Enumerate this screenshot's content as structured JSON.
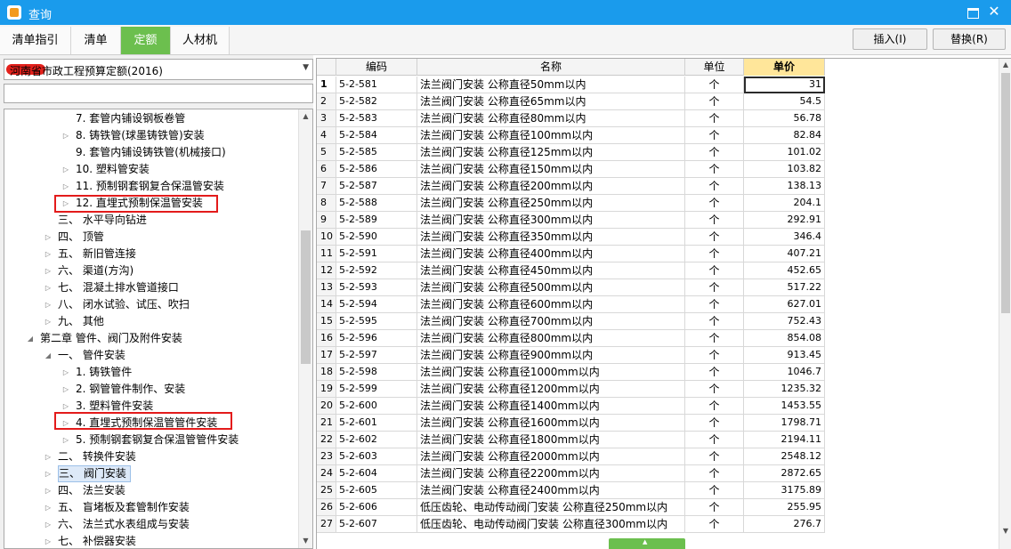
{
  "window": {
    "title": "查询"
  },
  "tabs": [
    {
      "label": "清单指引"
    },
    {
      "label": "清单"
    },
    {
      "label": "定额"
    },
    {
      "label": "人材机"
    }
  ],
  "buttons": {
    "insert": "插入(I)",
    "replace": "替换(R)"
  },
  "left": {
    "quota_library": "河南省市政工程预算定额(2016)",
    "search_value": "",
    "tree": [
      {
        "label": "7. 套管内铺设钢板卷管",
        "indent": 4,
        "arrow": ""
      },
      {
        "label": "8. 铸铁管(球墨铸铁管)安装",
        "indent": 4,
        "arrow": "▷"
      },
      {
        "label": "9. 套管内铺设铸铁管(机械接口)",
        "indent": 4,
        "arrow": ""
      },
      {
        "label": "10. 塑料管安装",
        "indent": 4,
        "arrow": "▷"
      },
      {
        "label": "11. 预制钢套钢复合保温管安装",
        "indent": 4,
        "arrow": "▷"
      },
      {
        "label": "12. 直埋式预制保温管安装",
        "indent": 4,
        "arrow": "▷"
      },
      {
        "label": "三、 水平导向钻进",
        "indent": 3,
        "arrow": ""
      },
      {
        "label": "四、 顶管",
        "indent": 3,
        "arrow": "▷"
      },
      {
        "label": "五、 新旧管连接",
        "indent": 3,
        "arrow": "▷"
      },
      {
        "label": "六、 渠道(方沟)",
        "indent": 3,
        "arrow": "▷"
      },
      {
        "label": "七、 混凝土排水管道接口",
        "indent": 3,
        "arrow": "▷"
      },
      {
        "label": "八、 闭水试验、试压、吹扫",
        "indent": 3,
        "arrow": "▷"
      },
      {
        "label": "九、 其他",
        "indent": 3,
        "arrow": "▷"
      },
      {
        "label": "第二章 管件、阀门及附件安装",
        "indent": 2,
        "arrow": "◢"
      },
      {
        "label": "一、 管件安装",
        "indent": 3,
        "arrow": "◢"
      },
      {
        "label": "1. 铸铁管件",
        "indent": 4,
        "arrow": "▷"
      },
      {
        "label": "2. 钢管管件制作、安装",
        "indent": 4,
        "arrow": "▷"
      },
      {
        "label": "3. 塑料管件安装",
        "indent": 4,
        "arrow": "▷"
      },
      {
        "label": "4. 直埋式预制保温管管件安装",
        "indent": 4,
        "arrow": "▷"
      },
      {
        "label": "5. 预制钢套钢复合保温管管件安装",
        "indent": 4,
        "arrow": "▷"
      },
      {
        "label": "二、 转换件安装",
        "indent": 3,
        "arrow": "▷"
      },
      {
        "label": "三、 阀门安装",
        "indent": 3,
        "arrow": "▷",
        "selected": true
      },
      {
        "label": "四、 法兰安装",
        "indent": 3,
        "arrow": "▷"
      },
      {
        "label": "五、 盲堵板及套管制作安装",
        "indent": 3,
        "arrow": "▷"
      },
      {
        "label": "六、 法兰式水表组成与安装",
        "indent": 3,
        "arrow": "▷"
      },
      {
        "label": "七、 补偿器安装",
        "indent": 3,
        "arrow": "▷"
      }
    ]
  },
  "grid": {
    "headers": {
      "code": "编码",
      "name": "名称",
      "unit": "单位",
      "price": "单价"
    },
    "rows": [
      {
        "n": "1",
        "code": "5-2-581",
        "name": "法兰阀门安装 公称直径50mm以内",
        "unit": "个",
        "price": "31"
      },
      {
        "n": "2",
        "code": "5-2-582",
        "name": "法兰阀门安装 公称直径65mm以内",
        "unit": "个",
        "price": "54.5"
      },
      {
        "n": "3",
        "code": "5-2-583",
        "name": "法兰阀门安装 公称直径80mm以内",
        "unit": "个",
        "price": "56.78"
      },
      {
        "n": "4",
        "code": "5-2-584",
        "name": "法兰阀门安装 公称直径100mm以内",
        "unit": "个",
        "price": "82.84"
      },
      {
        "n": "5",
        "code": "5-2-585",
        "name": "法兰阀门安装 公称直径125mm以内",
        "unit": "个",
        "price": "101.02"
      },
      {
        "n": "6",
        "code": "5-2-586",
        "name": "法兰阀门安装 公称直径150mm以内",
        "unit": "个",
        "price": "103.82"
      },
      {
        "n": "7",
        "code": "5-2-587",
        "name": "法兰阀门安装 公称直径200mm以内",
        "unit": "个",
        "price": "138.13"
      },
      {
        "n": "8",
        "code": "5-2-588",
        "name": "法兰阀门安装 公称直径250mm以内",
        "unit": "个",
        "price": "204.1"
      },
      {
        "n": "9",
        "code": "5-2-589",
        "name": "法兰阀门安装 公称直径300mm以内",
        "unit": "个",
        "price": "292.91"
      },
      {
        "n": "10",
        "code": "5-2-590",
        "name": "法兰阀门安装 公称直径350mm以内",
        "unit": "个",
        "price": "346.4"
      },
      {
        "n": "11",
        "code": "5-2-591",
        "name": "法兰阀门安装 公称直径400mm以内",
        "unit": "个",
        "price": "407.21"
      },
      {
        "n": "12",
        "code": "5-2-592",
        "name": "法兰阀门安装 公称直径450mm以内",
        "unit": "个",
        "price": "452.65"
      },
      {
        "n": "13",
        "code": "5-2-593",
        "name": "法兰阀门安装 公称直径500mm以内",
        "unit": "个",
        "price": "517.22"
      },
      {
        "n": "14",
        "code": "5-2-594",
        "name": "法兰阀门安装 公称直径600mm以内",
        "unit": "个",
        "price": "627.01"
      },
      {
        "n": "15",
        "code": "5-2-595",
        "name": "法兰阀门安装 公称直径700mm以内",
        "unit": "个",
        "price": "752.43"
      },
      {
        "n": "16",
        "code": "5-2-596",
        "name": "法兰阀门安装 公称直径800mm以内",
        "unit": "个",
        "price": "854.08"
      },
      {
        "n": "17",
        "code": "5-2-597",
        "name": "法兰阀门安装 公称直径900mm以内",
        "unit": "个",
        "price": "913.45"
      },
      {
        "n": "18",
        "code": "5-2-598",
        "name": "法兰阀门安装 公称直径1000mm以内",
        "unit": "个",
        "price": "1046.7"
      },
      {
        "n": "19",
        "code": "5-2-599",
        "name": "法兰阀门安装 公称直径1200mm以内",
        "unit": "个",
        "price": "1235.32"
      },
      {
        "n": "20",
        "code": "5-2-600",
        "name": "法兰阀门安装 公称直径1400mm以内",
        "unit": "个",
        "price": "1453.55"
      },
      {
        "n": "21",
        "code": "5-2-601",
        "name": "法兰阀门安装 公称直径1600mm以内",
        "unit": "个",
        "price": "1798.71"
      },
      {
        "n": "22",
        "code": "5-2-602",
        "name": "法兰阀门安装 公称直径1800mm以内",
        "unit": "个",
        "price": "2194.11"
      },
      {
        "n": "23",
        "code": "5-2-603",
        "name": "法兰阀门安装 公称直径2000mm以内",
        "unit": "个",
        "price": "2548.12"
      },
      {
        "n": "24",
        "code": "5-2-604",
        "name": "法兰阀门安装 公称直径2200mm以内",
        "unit": "个",
        "price": "2872.65"
      },
      {
        "n": "25",
        "code": "5-2-605",
        "name": "法兰阀门安装 公称直径2400mm以内",
        "unit": "个",
        "price": "3175.89"
      },
      {
        "n": "26",
        "code": "5-2-606",
        "name": "低压齿轮、电动传动阀门安装 公称直径250mm以内",
        "unit": "个",
        "price": "255.95"
      },
      {
        "n": "27",
        "code": "5-2-607",
        "name": "低压齿轮、电动传动阀门安装 公称直径300mm以内",
        "unit": "个",
        "price": "276.7"
      }
    ]
  },
  "colors": {
    "titlebar": "#1a9bec",
    "active_tab": "#6cbf4e",
    "price_header": "#ffe69a",
    "highlight_box": "#e31b1b"
  }
}
